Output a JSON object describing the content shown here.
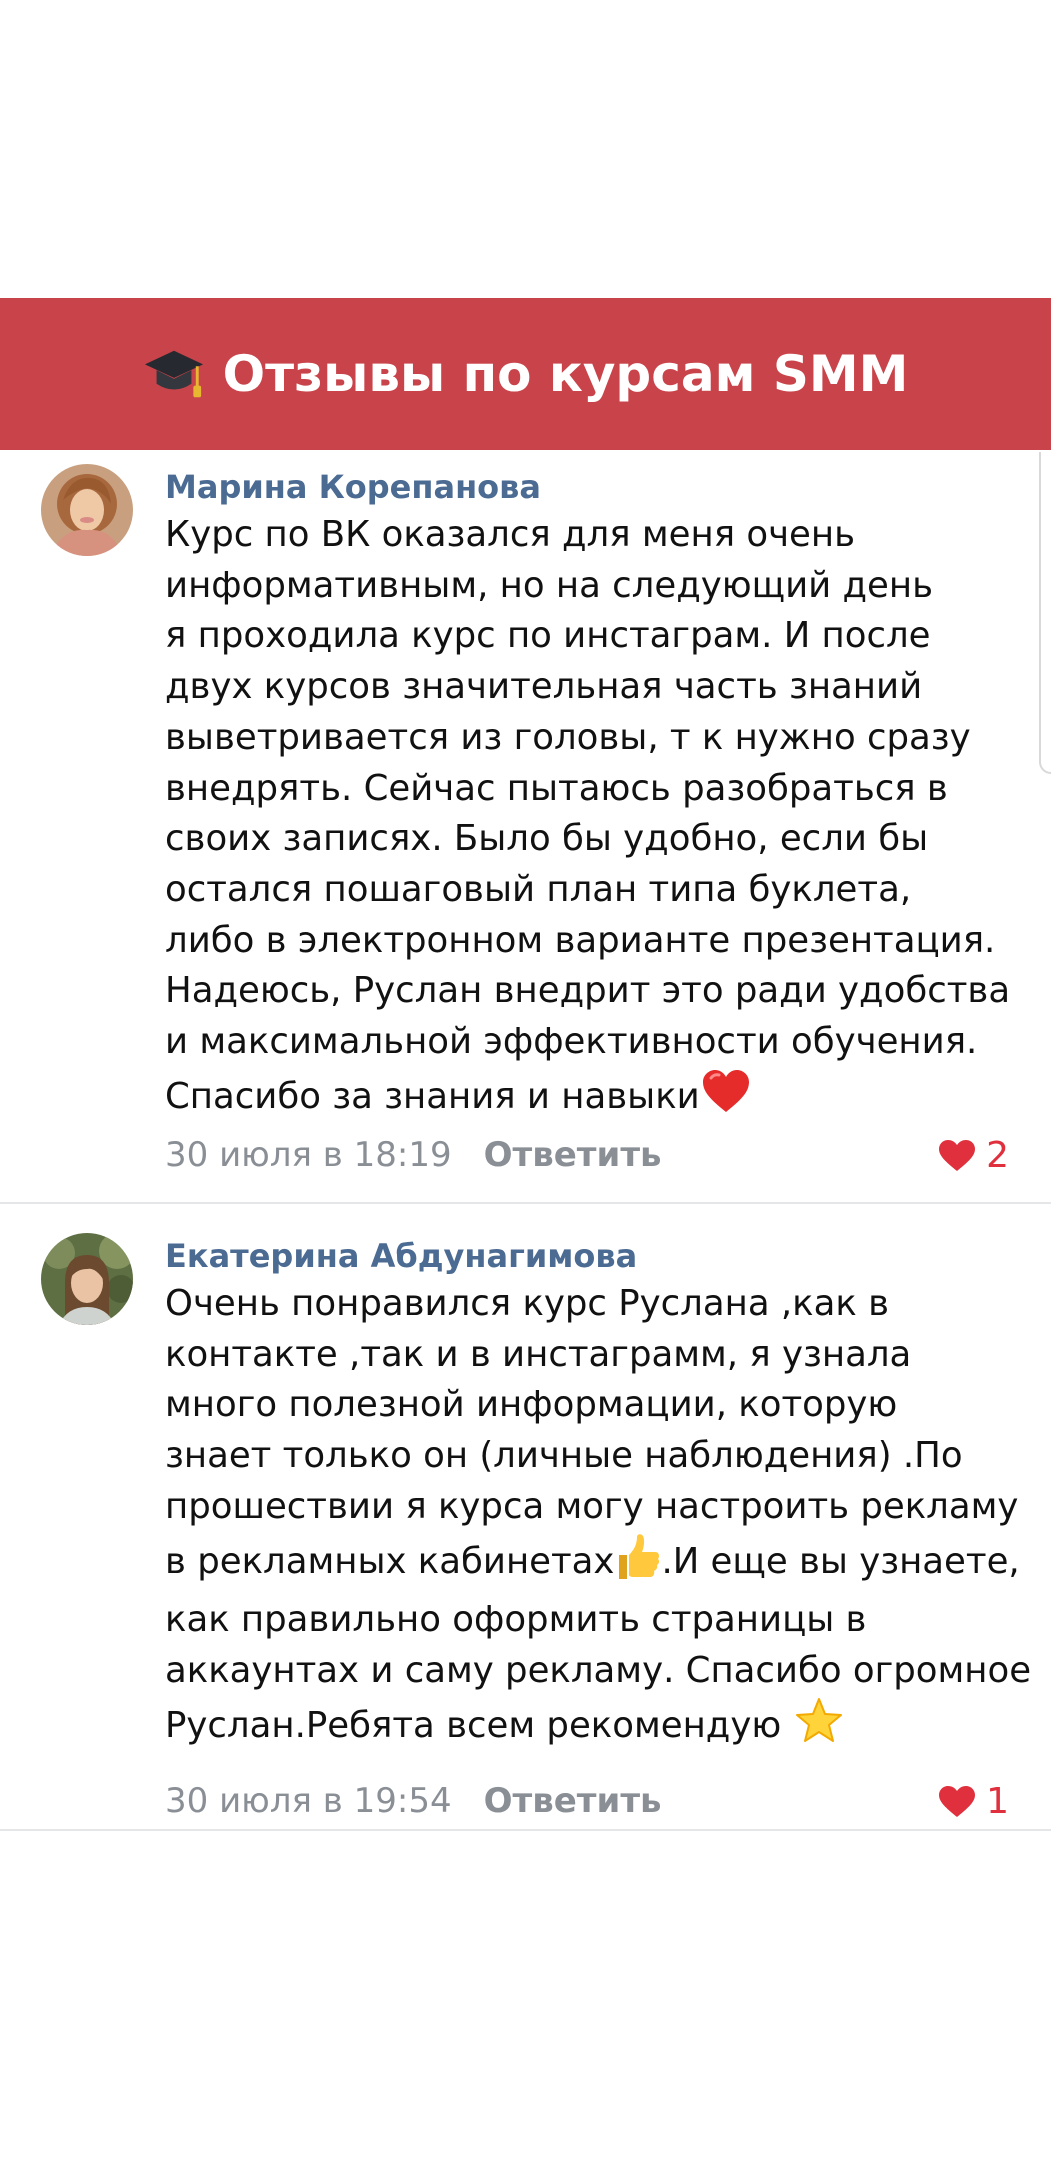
{
  "header": {
    "title": "Отзывы по курсам SMM",
    "icon": "graduation-cap-icon",
    "background_color": "#c8444a"
  },
  "comments": [
    {
      "author": "Марина Корепанова",
      "lines": [
        "Курс по ВК оказался для меня очень",
        "информативным, но на следующий день",
        "я проходила курс по инстаграм. И после",
        "двух курсов значительная часть знаний",
        "выветривается из головы, т к нужно сразу",
        "внедрять. Сейчас пытаюсь разобраться в",
        "своих записях. Было бы удобно, если бы",
        "остался пошаговый план типа буклета,",
        "либо в электронном варианте презентация.",
        "Надеюсь, Руслан внедрит это ради удобства",
        "и максимальной эффективности обучения.",
        "Спасибо за знания и навыки"
      ],
      "trailing_emoji": "red-heart-emoji",
      "date": "30 июля в 18:19",
      "reply_label": "Ответить",
      "likes": "2"
    },
    {
      "author": "Екатерина Абдунагимова",
      "lines": [
        "Очень понравился курс Руслана ,как в",
        "контакте ,так и в инстаграмм, я узнала",
        "много полезной информации, которую",
        "знает только он (личные наблюдения) .По",
        "прошествии я курса могу настроить рекламу",
        "в рекламных кабинетах",
        ".И еще вы узнаете,",
        "как правильно оформить страницы в",
        "аккаунтах и саму рекламу. Спасибо огромное",
        "Руслан.Ребята всем рекомендую"
      ],
      "inline_emoji": "thumbs-up-emoji",
      "trailing_emoji": "star-emoji",
      "date": "30 июля в 19:54",
      "reply_label": "Ответить",
      "likes": "1"
    }
  ],
  "colors": {
    "author_name": "#4b6b93",
    "meta_text": "#8a8f96",
    "like_red": "#e0303d",
    "divider": "#e5e6e8"
  }
}
